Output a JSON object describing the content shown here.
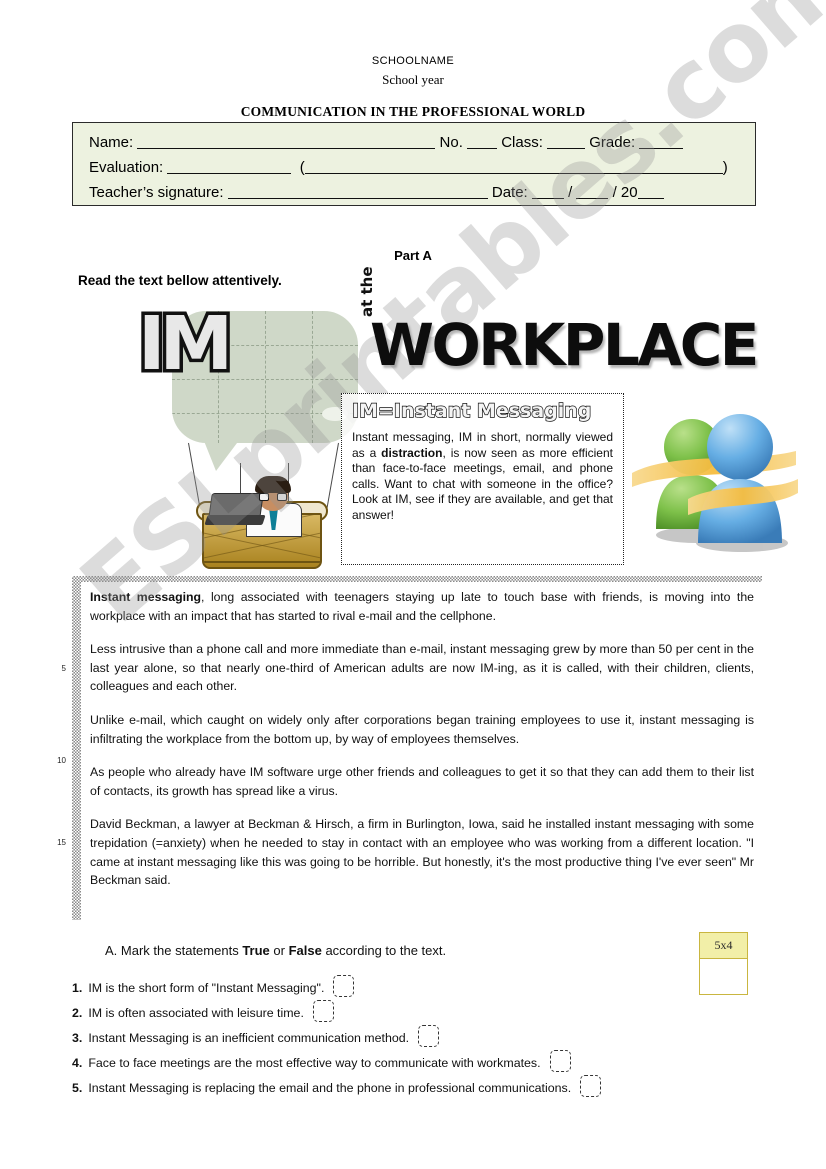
{
  "header": {
    "school_name": "SCHOOLNAME",
    "school_year": "School year",
    "doc_title": "COMMUNICATION IN THE PROFESSIONAL WORLD"
  },
  "id_box": {
    "bg_color": "#edf2e0",
    "row1_name_label": "Name:",
    "row1_no_label": "No.",
    "row1_class_label": "Class:",
    "row1_grade_label": "Grade:",
    "row2_evaluation_label": "Evaluation:",
    "row3_signature_label": "Teacher’s signature:",
    "row3_date_label": "Date:",
    "row3_date_suffix": "/ 20"
  },
  "part": {
    "label": "Part A",
    "instruction": "Read the text bellow attentively."
  },
  "graphic": {
    "im_logo": "IM",
    "at_the": "at the",
    "workplace": "WORKPLACE",
    "balloon_alt": "hot-air-balloon-speech-bubble-with-businessman-and-laptop",
    "messenger_alt": "msn-messenger-two-people-icon",
    "messenger_green": "#7ec14a",
    "messenger_blue": "#5aa6e0",
    "messenger_swoosh": "#f5c04a"
  },
  "definition": {
    "title": "IM=Instant Messaging",
    "text_before_bold": "Instant messaging, IM in short, normally viewed as a ",
    "bold_word": "distraction",
    "text_after_bold": ", is now seen as more efficient than face-to-face meetings, email, and phone calls. Want to chat with someone in the office? Look at IM, see if they are available, and get that answer!"
  },
  "reading_text": {
    "p1_bold": "Instant messaging",
    "p1_rest": ", long associated with teenagers staying up late to touch base with friends, is moving into the workplace with an impact that has started to rival e-mail and the cellphone.",
    "p2": "Less intrusive than a phone call and more immediate than e-mail, instant messaging grew by more than 50 per cent in the last year alone, so that nearly one-third of American adults are now IM-ing, as it is called, with their children, clients, colleagues and each other.",
    "p3": "Unlike e-mail, which caught on widely only after corporations began training employees to use it, instant messaging is infiltrating the workplace from the bottom up, by way of employees themselves.",
    "p4": "As people who already have IM software urge other friends and colleagues to get it so that they can add them to their list of contacts, its growth has spread like a virus.",
    "p5": "David Beckman, a lawyer at Beckman & Hirsch, a firm in Burlington, Iowa, said he installed instant messaging with some trepidation (=anxiety) when he needed to stay in contact with an employee who was working from a different location. \"I came at instant messaging like this was going to be horrible. But honestly, it's the most productive thing I've ever seen\" Mr Beckman said.",
    "line_numbers": [
      "5",
      "10",
      "15"
    ]
  },
  "exercise_a": {
    "letter": "A.",
    "prompt_before": "Mark the statements ",
    "true_word": "True",
    "prompt_or": " or ",
    "false_word": "False",
    "prompt_after": " according to the text.",
    "statements": [
      {
        "num": "1.",
        "text": "IM is the short form of \"Instant Messaging\"."
      },
      {
        "num": "2.",
        "text": "IM is often associated with leisure time."
      },
      {
        "num": "3.",
        "text": "Instant Messaging is an inefficient communication method."
      },
      {
        "num": "4.",
        "text": "Face to face meetings are the most effective way to communicate with workmates."
      },
      {
        "num": "5.",
        "text": "Instant Messaging is replacing the email and the phone in professional communications."
      }
    ]
  },
  "score_box": {
    "label": "5x4",
    "value": "",
    "border_color": "#c9b640",
    "fill_color": "#f2efa8"
  },
  "watermark": {
    "text": "ESLprintables.com"
  }
}
